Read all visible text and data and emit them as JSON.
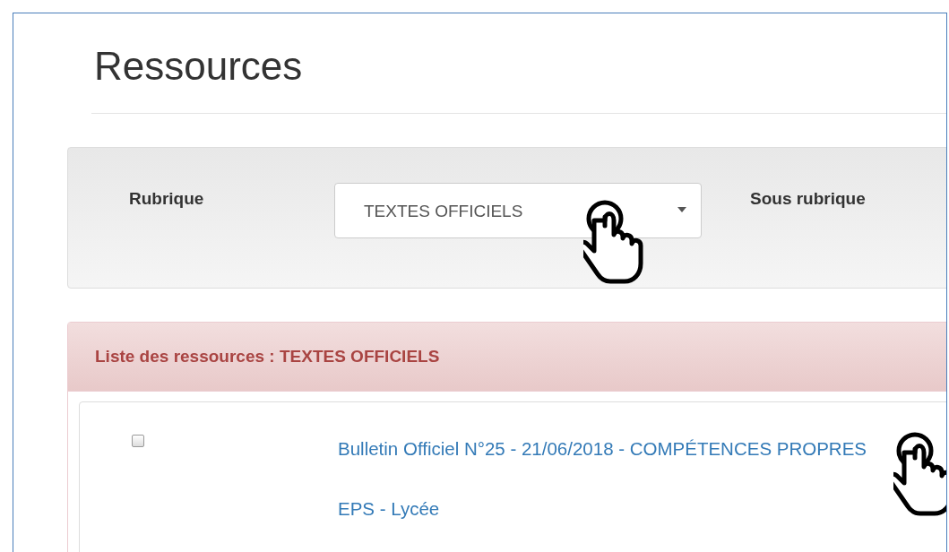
{
  "page": {
    "title": "Ressources"
  },
  "filters": [
    {
      "label": "Rubrique",
      "value": "TEXTES OFFICIELS"
    },
    {
      "label": "Sous rubrique"
    }
  ],
  "resources_panel": {
    "heading": "Liste des ressources : ",
    "category": "TEXTES OFFICIELS",
    "items": [
      {
        "title": "Bulletin Officiel N°25 - 21/06/2018 - COMPÉTENCES PROPRES EPS - Lycée",
        "checked": false
      }
    ]
  }
}
